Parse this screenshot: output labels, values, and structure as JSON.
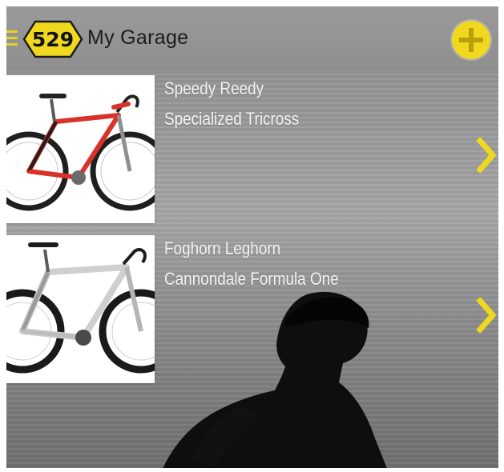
{
  "header": {
    "logo_text": "529",
    "title": "My Garage",
    "menu_icon": "hamburger-menu-icon",
    "add_icon": "add-circle-icon"
  },
  "bikes": [
    {
      "nickname": "Speedy Reedy",
      "model": "Specialized Tricross",
      "frame_color": "#d9322b",
      "chevron_icon": "chevron-right-icon"
    },
    {
      "nickname": "Foghorn Leghorn",
      "model": "Cannondale Formula One",
      "frame_color": "#d6d6d6",
      "chevron_icon": "chevron-right-icon"
    }
  ],
  "colors": {
    "accent": "#f0d81e",
    "background": "#8f8f8f",
    "text": "#f4f4f4",
    "title_text": "#1b1b1b"
  }
}
